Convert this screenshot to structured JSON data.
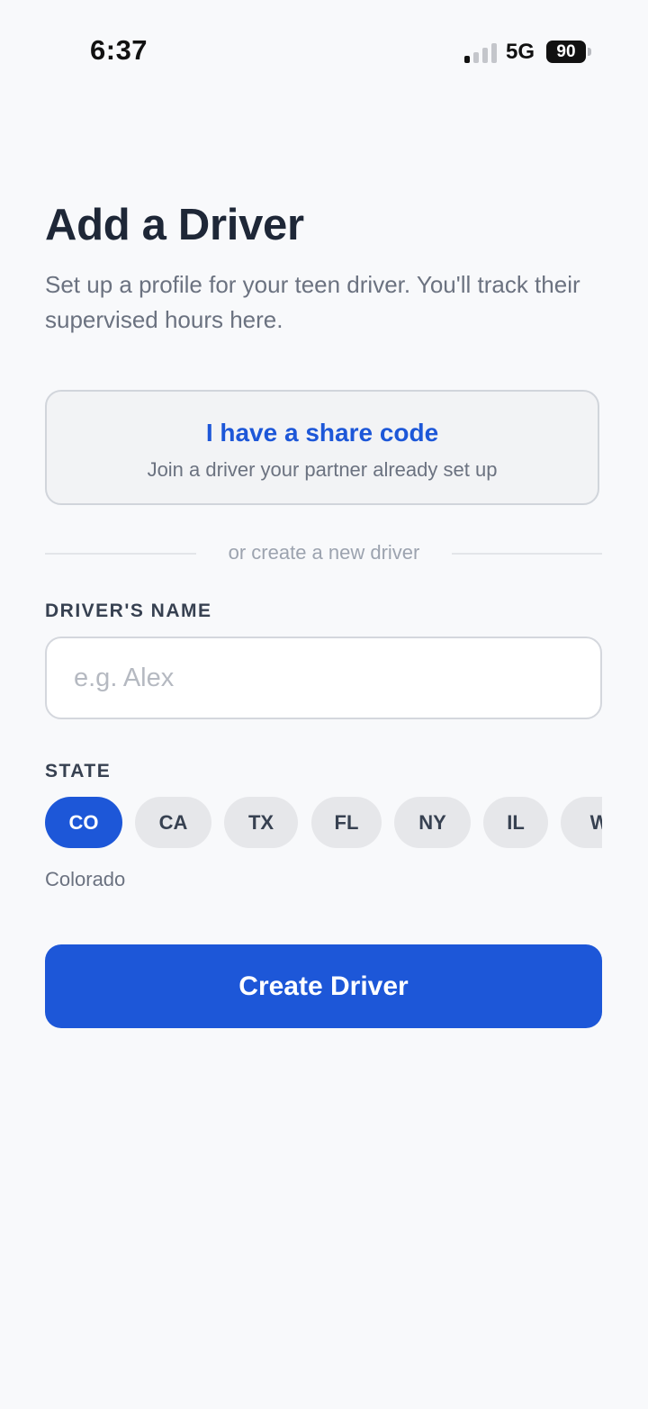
{
  "status_bar": {
    "time": "6:37",
    "network": "5G",
    "battery": "90",
    "signal_bars_active": 1,
    "signal_bars_total": 4
  },
  "header": {
    "title": "Add a Driver",
    "subtitle": "Set up a profile for your teen driver. You'll track their supervised hours here."
  },
  "share_code": {
    "title": "I have a share code",
    "subtitle": "Join a driver your partner already set up"
  },
  "divider": {
    "text": "or create a new driver"
  },
  "name_field": {
    "label": "DRIVER'S NAME",
    "value": "",
    "placeholder": "e.g. Alex"
  },
  "state_field": {
    "label": "STATE",
    "options": [
      "CO",
      "CA",
      "TX",
      "FL",
      "NY",
      "IL",
      "W"
    ],
    "selected": "CO",
    "selected_name": "Colorado"
  },
  "actions": {
    "create_label": "Create Driver"
  },
  "colors": {
    "accent": "#1d57d8",
    "background": "#f8f9fb",
    "chip_background": "#e6e7ea"
  }
}
